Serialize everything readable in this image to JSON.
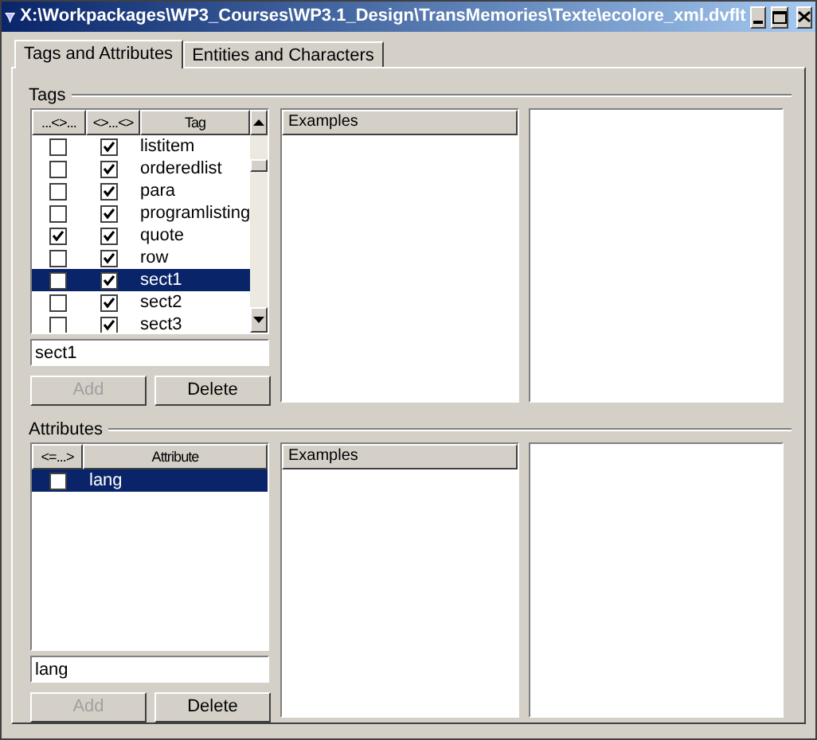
{
  "window": {
    "title": "X:\\Workpackages\\WP3_Courses\\WP3.1_Design\\TransMemories\\Texte\\ecolore_xml.dvflt"
  },
  "tabs": [
    {
      "label": "Tags and Attributes",
      "selected": true
    },
    {
      "label": "Entities and Characters",
      "selected": false
    }
  ],
  "tags": {
    "label": "Tags",
    "columns": [
      "...<>...",
      "<>...<>",
      "Tag"
    ],
    "rows": [
      {
        "col1": false,
        "col2": true,
        "tag": "listitem",
        "selected": false
      },
      {
        "col1": false,
        "col2": true,
        "tag": "orderedlist",
        "selected": false
      },
      {
        "col1": false,
        "col2": true,
        "tag": "para",
        "selected": false
      },
      {
        "col1": false,
        "col2": true,
        "tag": "programlisting",
        "selected": false
      },
      {
        "col1": true,
        "col2": true,
        "tag": "quote",
        "selected": false
      },
      {
        "col1": false,
        "col2": true,
        "tag": "row",
        "selected": false
      },
      {
        "col1": false,
        "col2": true,
        "tag": "sect1",
        "selected": true
      },
      {
        "col1": false,
        "col2": true,
        "tag": "sect2",
        "selected": false
      },
      {
        "col1": false,
        "col2": true,
        "tag": "sect3",
        "selected": false
      }
    ],
    "field": "sect1",
    "buttons": [
      {
        "label": "Add",
        "disabled": true
      },
      {
        "label": "Delete",
        "disabled": false
      }
    ],
    "examples_header": "Examples"
  },
  "attributes": {
    "label": "Attributes",
    "columns": [
      "<=...>",
      "Attribute"
    ],
    "rows": [
      {
        "col1": false,
        "attribute": "lang",
        "selected": true
      }
    ],
    "field": "lang",
    "buttons": [
      {
        "label": "Add",
        "disabled": true
      },
      {
        "label": "Delete",
        "disabled": false
      }
    ],
    "examples_header": "Examples"
  }
}
